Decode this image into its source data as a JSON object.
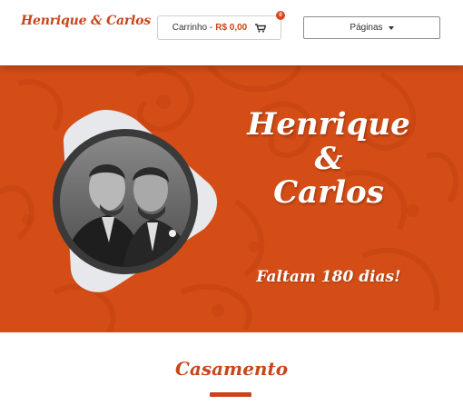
{
  "header": {
    "brand": "Henrique & Carlos",
    "cart": {
      "label": "Carrinho -",
      "total": "R$ 0,00",
      "badge_count": "0"
    },
    "pages_label": "Páginas"
  },
  "hero": {
    "name_1": "Henrique",
    "ampersand": "&",
    "name_2": "Carlos",
    "countdown": "Faltam 180 dias!"
  },
  "section": {
    "title": "Casamento"
  },
  "colors": {
    "accent": "#c9451a",
    "hero_background": "#d44d17"
  }
}
